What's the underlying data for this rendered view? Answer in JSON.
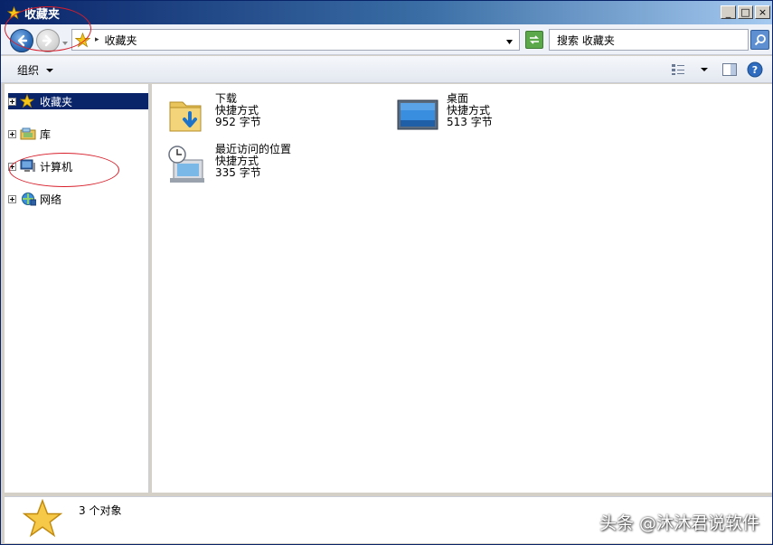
{
  "window": {
    "title": "收藏夹",
    "buttons": {
      "minimize": "_",
      "maximize": "□",
      "close": "×"
    }
  },
  "address_bar": {
    "path": "收藏夹",
    "search_placeholder": "搜索 收藏夹"
  },
  "toolbar": {
    "organize_label": "组织",
    "views_icon": "views-icon",
    "preview_icon": "preview-pane-icon",
    "help_icon": "help-icon"
  },
  "nav_tree": [
    {
      "label": "收藏夹",
      "icon": "star-icon",
      "selected": true
    },
    {
      "label": "库",
      "icon": "library-icon",
      "selected": false
    },
    {
      "label": "计算机",
      "icon": "computer-icon",
      "selected": false
    },
    {
      "label": "网络",
      "icon": "network-icon",
      "selected": false
    }
  ],
  "items": [
    {
      "name": "下载",
      "type": "快捷方式",
      "size": "952 字节",
      "icon": "downloads-folder-icon"
    },
    {
      "name": "桌面",
      "type": "快捷方式",
      "size": "513 字节",
      "icon": "desktop-icon"
    },
    {
      "name": "最近访问的位置",
      "type": "快捷方式",
      "size": "335 字节",
      "icon": "recent-places-icon"
    }
  ],
  "status": {
    "count_text": "3 个对象",
    "watermark": "头条 @沐沐君说软件"
  },
  "colors": {
    "selection": "#0a246a",
    "annotation": "#d81e2a",
    "accent": "#3a6ea5"
  }
}
